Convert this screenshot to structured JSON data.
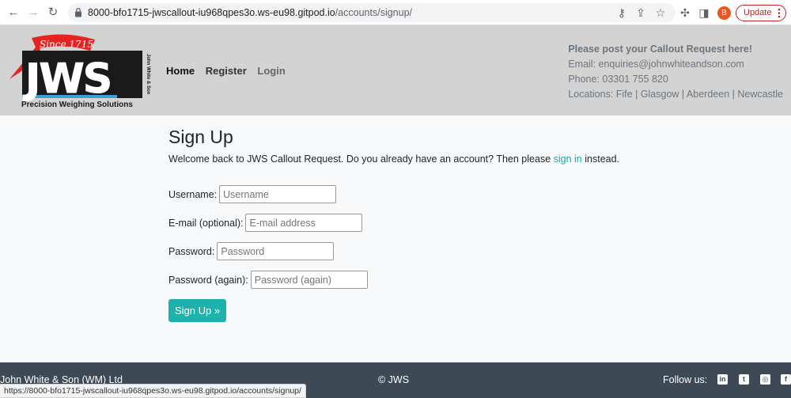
{
  "browser": {
    "url_host": "8000-bfo1715-jwscallout-iu968qpes3o.ws-eu98.gitpod.io",
    "url_path": "/accounts/signup/",
    "profile_initial": "B",
    "update_label": "Update",
    "status_url": "https://8000-bfo1715-jwscallout-iu968qpes3o.ws-eu98.gitpod.io/accounts/signup/"
  },
  "logo": {
    "since": "Since 1715",
    "letters": "JWS",
    "side_text": "John White & Son",
    "tagline": "Precision Weighing Solutions"
  },
  "nav": {
    "home": "Home",
    "register": "Register",
    "login": "Login"
  },
  "contact": {
    "cta": "Please post your Callout Request here!",
    "email": "Email: enquiries@johnwhiteandson.com",
    "phone": "Phone: 03301 755 820",
    "locations": "Locations: Fife | Glasgow | Aberdeen | Newcastle"
  },
  "main": {
    "title": "Sign Up",
    "intro_before": "Welcome back to JWS Callout Request. Do you already have an account? Then please ",
    "intro_link": "sign in",
    "intro_after": " instead.",
    "fields": {
      "username_label": "Username:",
      "username_placeholder": "Username",
      "email_label": "E-mail (optional):",
      "email_placeholder": "E-mail address",
      "password_label": "Password:",
      "password_placeholder": "Password",
      "password2_label": "Password (again):",
      "password2_placeholder": "Password (again)"
    },
    "submit_label": "Sign Up »"
  },
  "footer": {
    "company": "John White & Son (WM) Ltd",
    "copyright": "© JWS",
    "follow": "Follow us:"
  },
  "colors": {
    "header_bg": "#d3d3d3",
    "accent": "#1db3ac",
    "footer_bg": "#3d4a55",
    "logo_red": "#e52421"
  }
}
